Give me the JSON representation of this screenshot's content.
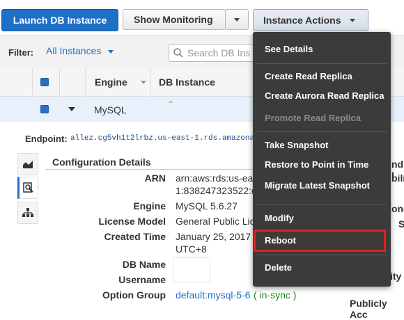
{
  "toolbar": {
    "launch_label": "Launch DB Instance",
    "monitoring_label": "Show Monitoring",
    "actions_label": "Instance Actions"
  },
  "filter": {
    "label": "Filter:",
    "value": "All Instances",
    "search_placeholder": "Search DB Ins"
  },
  "table": {
    "headers": [
      "Engine",
      "DB Instance"
    ],
    "rows": [
      {
        "engine": "MySQL",
        "instance": "¨"
      }
    ]
  },
  "details": {
    "endpoint_label": "Endpoint:",
    "endpoint_value": "allez.cg5vh1t2lrbz.us-east-1.rds.amazona",
    "section_title": "Configuration Details",
    "fields": {
      "arn_label": "ARN",
      "arn_value_1": "arn:aws:rds:us-east-",
      "arn_value_2": "1:838247323522:d",
      "engine_label": "Engine",
      "engine_value": "MySQL 5.6.27",
      "license_label": "License Model",
      "license_value": "General Public Lic",
      "created_label": "Created Time",
      "created_value_1": "January 25, 2017 ;",
      "created_value_2": "UTC+8",
      "dbname_label": "DB Name",
      "username_label": "Username",
      "option_label": "Option Group",
      "option_value": "default:mysql-5-6",
      "option_status": "in-sync"
    },
    "right_fragments": [
      "nd I",
      "bili",
      "one",
      "S",
      "ity",
      "Publicly Acc"
    ]
  },
  "menu": {
    "items": [
      {
        "label": "See Details",
        "enabled": true
      },
      {
        "label": "Create Read Replica",
        "enabled": true
      },
      {
        "label": "Create Aurora Read Replica",
        "enabled": true
      },
      {
        "label": "Promote Read Replica",
        "enabled": false
      },
      {
        "label": "Take Snapshot",
        "enabled": true
      },
      {
        "label": "Restore to Point in Time",
        "enabled": true
      },
      {
        "label": "Migrate Latest Snapshot",
        "enabled": true
      },
      {
        "label": "Modify",
        "enabled": true
      },
      {
        "label": "Reboot",
        "enabled": true
      },
      {
        "label": "Delete",
        "enabled": true
      }
    ]
  },
  "colors": {
    "primary": "#1f6fc7",
    "link": "#1f6fc7",
    "menu_bg": "#3b3b3b",
    "highlight": "#e02020",
    "in_sync": "#1a8a1a"
  }
}
